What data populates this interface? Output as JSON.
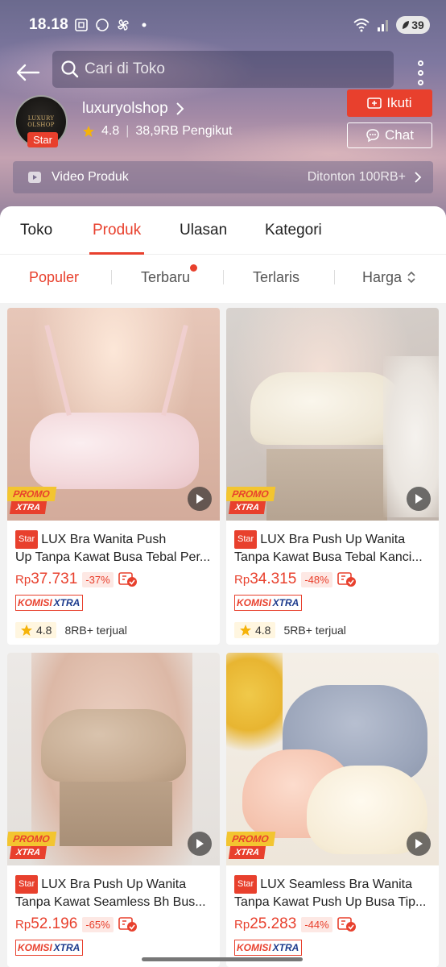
{
  "status_bar": {
    "time": "18.18",
    "battery": "39"
  },
  "search": {
    "placeholder": "Cari di Toko"
  },
  "shop": {
    "name": "luxuryolshop",
    "badge": "Star",
    "rating": "4.8",
    "followers": "38,9RB Pengikut",
    "logo_text": "LUXURY OLSHOP"
  },
  "actions": {
    "follow_label": "Ikuti",
    "chat_label": "Chat"
  },
  "video_bar": {
    "label": "Video Produk",
    "views": "Ditonton 100RB+"
  },
  "tabs": [
    {
      "label": "Toko",
      "active": false
    },
    {
      "label": "Produk",
      "active": true
    },
    {
      "label": "Ulasan",
      "active": false
    },
    {
      "label": "Kategori",
      "active": false
    }
  ],
  "sort": [
    {
      "label": "Populer",
      "active": true
    },
    {
      "label": "Terbaru",
      "active": false,
      "dot": true
    },
    {
      "label": "Terlaris",
      "active": false
    },
    {
      "label": "Harga",
      "active": false
    }
  ],
  "promo": {
    "line1": "PROMO",
    "line2": "XTRA"
  },
  "komisi": {
    "k1": "KOMISI",
    "k2": "XTRA"
  },
  "products": [
    {
      "badge": "Star",
      "title_line1": "LUX Bra Wanita Push",
      "title_line2": "Up Tanpa Kawat Busa Tebal Per...",
      "currency": "Rp",
      "price": "37.731",
      "discount": "-37%",
      "rating": "4.8",
      "sold": "8RB+ terjual"
    },
    {
      "badge": "Star",
      "title_line1": "LUX Bra Push Up Wanita",
      "title_line2": "Tanpa Kawat Busa Tebal Kanci...",
      "currency": "Rp",
      "price": "34.315",
      "discount": "-48%",
      "rating": "4.8",
      "sold": "5RB+ terjual"
    },
    {
      "badge": "Star",
      "title_line1": "LUX Bra Push Up Wanita",
      "title_line2": "Tanpa Kawat Seamless Bh Bus...",
      "currency": "Rp",
      "price": "52.196",
      "discount": "-65%"
    },
    {
      "badge": "Star",
      "title_line1": "LUX Seamless Bra Wanita",
      "title_line2": "Tanpa Kawat Push Up Busa Tip...",
      "currency": "Rp",
      "price": "25.283",
      "discount": "-44%"
    }
  ],
  "colors": {
    "accent": "#e8402d",
    "promo_yellow": "#f3c530",
    "komisi_blue": "#1b3a8c"
  }
}
